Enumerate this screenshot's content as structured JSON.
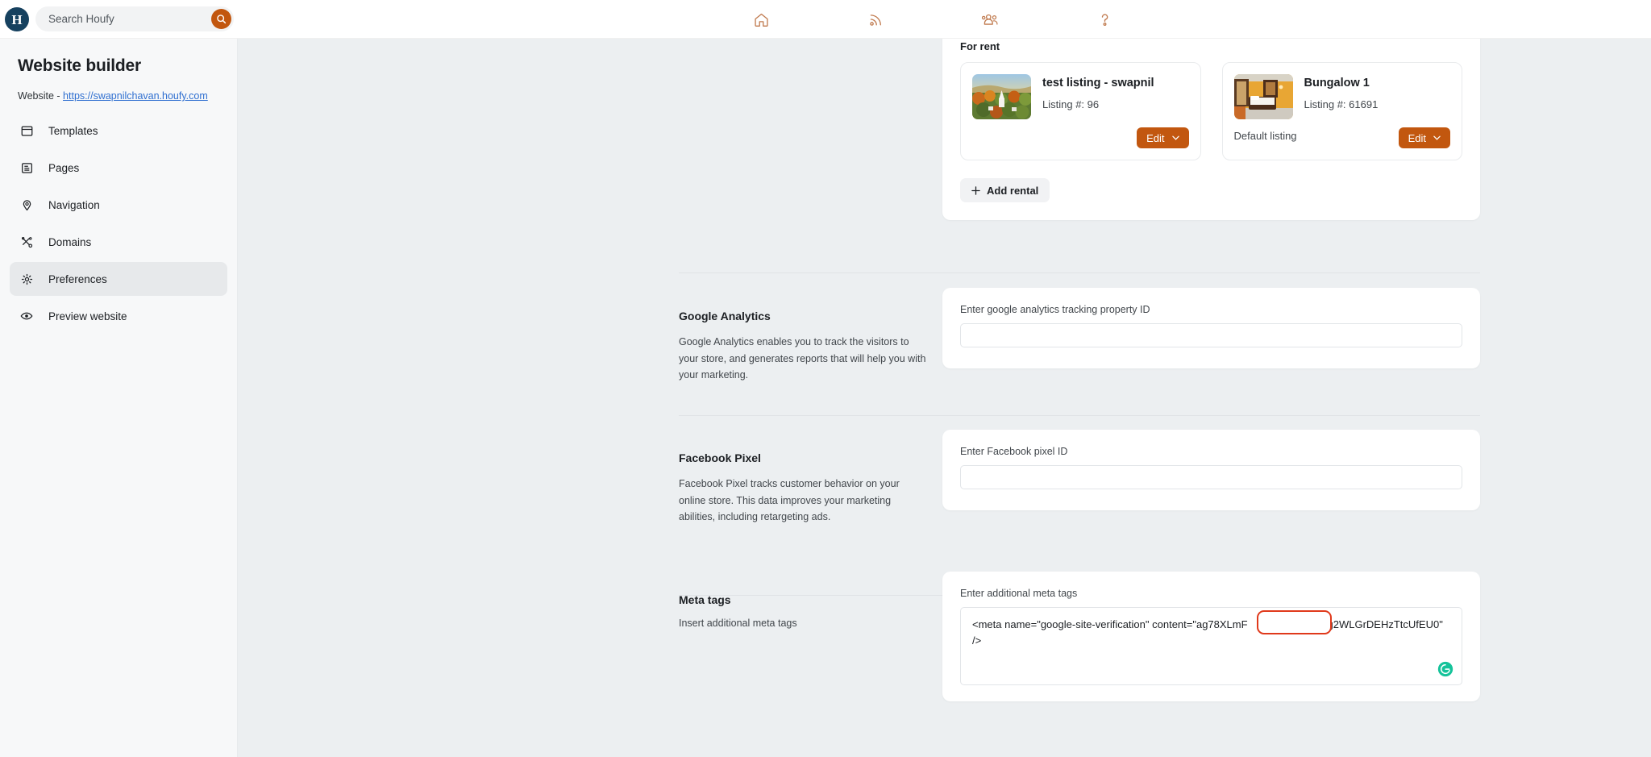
{
  "topbar": {
    "logo_name": "houfy-logo",
    "search": {
      "placeholder": "Search Houfy",
      "value": ""
    },
    "nav": [
      {
        "icon": "home-icon",
        "name": "nav-home"
      },
      {
        "icon": "rss-feed-icon",
        "name": "nav-feed"
      },
      {
        "icon": "people-group-icon",
        "name": "nav-community"
      },
      {
        "icon": "question-mark-icon",
        "name": "nav-help"
      }
    ]
  },
  "sidebar": {
    "title": "Website builder",
    "website_prefix": "Website - ",
    "website_url": "https://swapnilchavan.houfy.com",
    "items": [
      {
        "label": "Templates",
        "icon": "window-icon",
        "active": false
      },
      {
        "label": "Pages",
        "icon": "document-list-icon",
        "active": false
      },
      {
        "label": "Navigation",
        "icon": "map-pin-icon",
        "active": false
      },
      {
        "label": "Domains",
        "icon": "tools-icon",
        "active": false
      },
      {
        "label": "Preferences",
        "icon": "gear-icon",
        "active": true
      },
      {
        "label": "Preview website",
        "icon": "eye-icon",
        "active": false
      }
    ]
  },
  "rentals": {
    "heading": "For rent",
    "add_button": "Add rental",
    "cards": [
      {
        "name": "test listing - swapnil",
        "listing_label": "Listing #: 96",
        "default_label": "",
        "edit_label": "Edit",
        "thumb": "autumn-village-photo"
      },
      {
        "name": "Bungalow 1",
        "listing_label": "Listing #: 61691",
        "default_label": "Default listing",
        "edit_label": "Edit",
        "thumb": "bedroom-photo"
      }
    ]
  },
  "sections": [
    {
      "title": "Google Analytics",
      "description": "Google Analytics enables you to track the visitors to your store, and generates reports that will help you with your marketing.",
      "field_label": "Enter google analytics tracking property ID",
      "field_value": "",
      "field_placeholder": ""
    },
    {
      "title": "Facebook Pixel",
      "description": "Facebook Pixel tracks customer behavior on your online store. This data improves your marketing abilities, including retargeting ads.",
      "field_label": "Enter Facebook pixel ID",
      "field_value": "",
      "field_placeholder": ""
    }
  ],
  "meta_tags": {
    "title": "Meta tags",
    "description": "Insert additional meta tags",
    "field_label": "Enter additional meta tags",
    "value": "<meta name=\"google-site-verification\" content=\"ag78XLmF                  UU-tgg2WLGrDEHzTtcUfEU0\" />",
    "redaction_present": true,
    "grammarly_icon": "grammarly-icon"
  },
  "colors": {
    "accent_orange": "#c2570f",
    "logo_navy": "#16415f",
    "link_blue": "#2f6fd0",
    "page_bg": "#eceff1",
    "sidebar_bg": "#f7f8f9",
    "redaction_red": "#e0391b",
    "grammarly_green": "#15c39a"
  }
}
